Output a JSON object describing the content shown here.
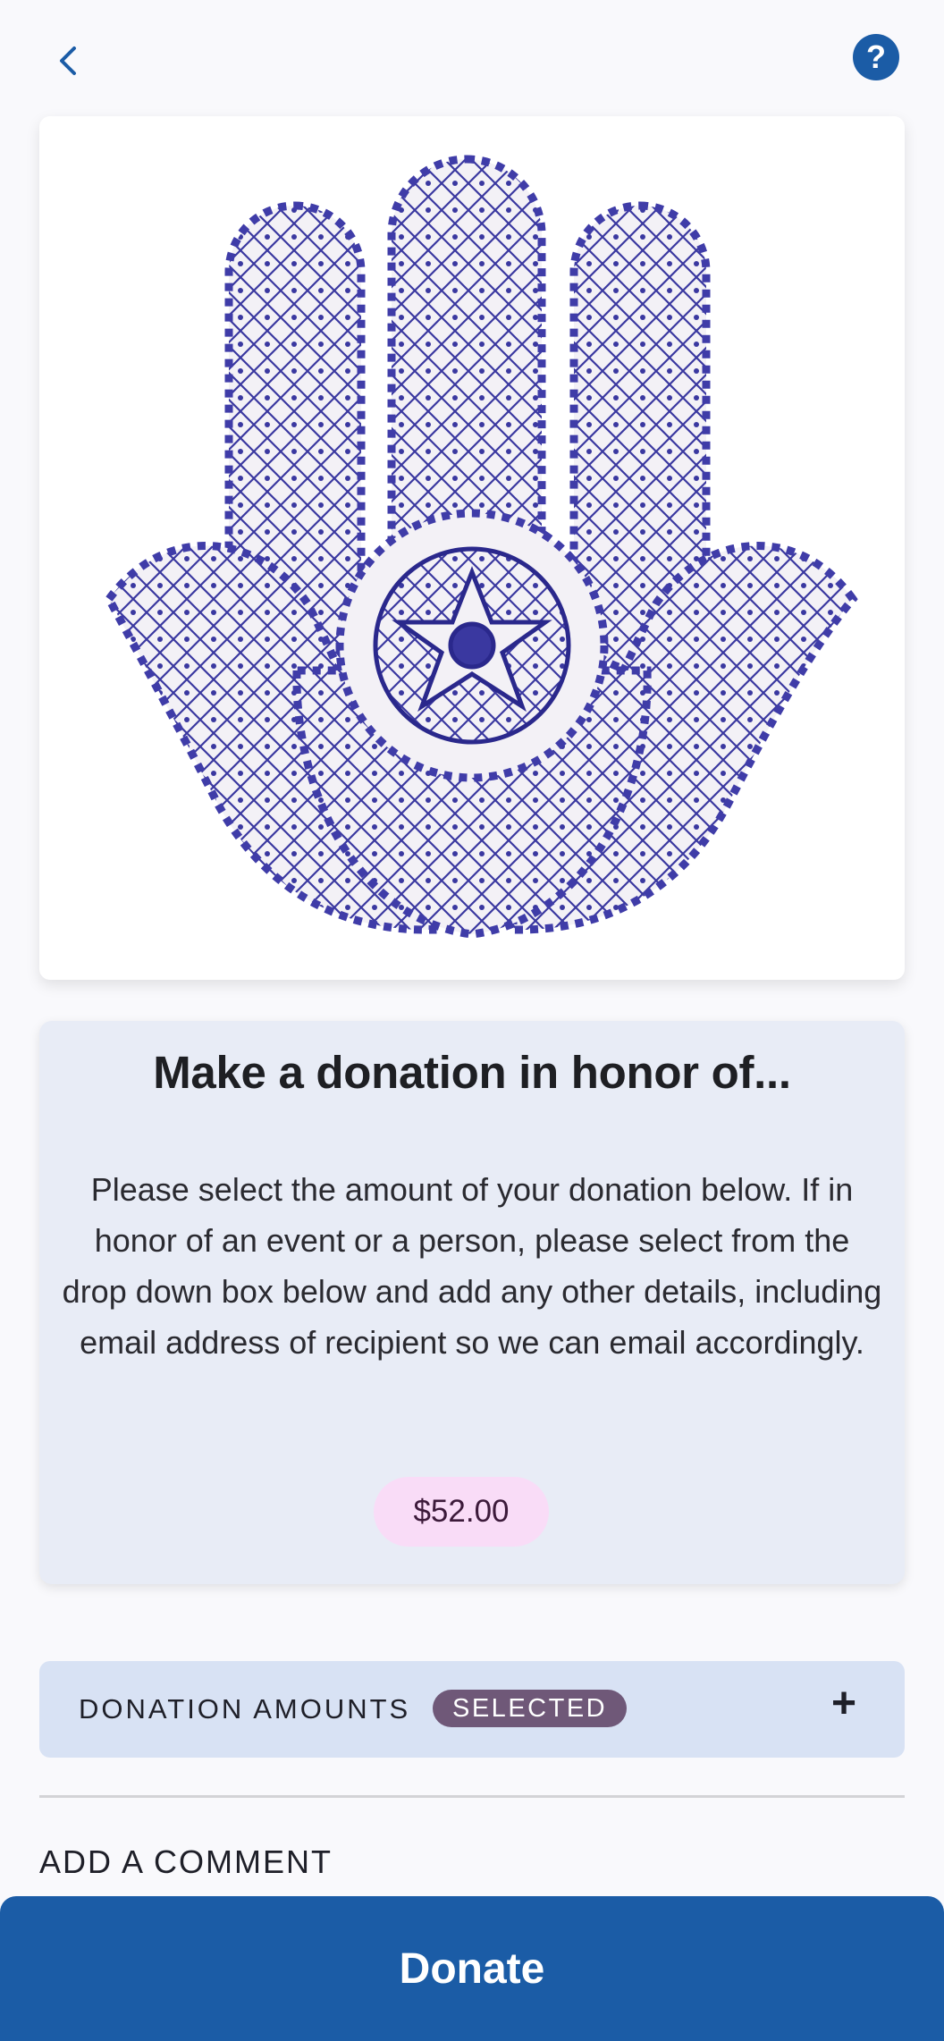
{
  "nav": {
    "back_icon": "chevron-left-icon",
    "help_icon": "question-mark-icon",
    "help_glyph": "?"
  },
  "hero": {
    "image_subject": "hamsa-hand-ceramic"
  },
  "donation": {
    "title": "Make a donation in honor of...",
    "description": "Please select the amount of your donation below. If in honor of an event or a person, please select from the drop down box below and add any other details, including email address of recipient so we can email accordingly.",
    "amount": "$52.00"
  },
  "accordion": {
    "label": "DONATION AMOUNTS",
    "badge": "SELECTED",
    "toggle": "+"
  },
  "comment": {
    "label": "ADD A COMMENT"
  },
  "footer": {
    "donate_label": "Donate"
  },
  "colors": {
    "primary": "#1b5ca6",
    "badge": "#6f5878",
    "pill": "#f9dcf7",
    "card": "#e8ecf6",
    "accordion": "#d8e2f4"
  }
}
